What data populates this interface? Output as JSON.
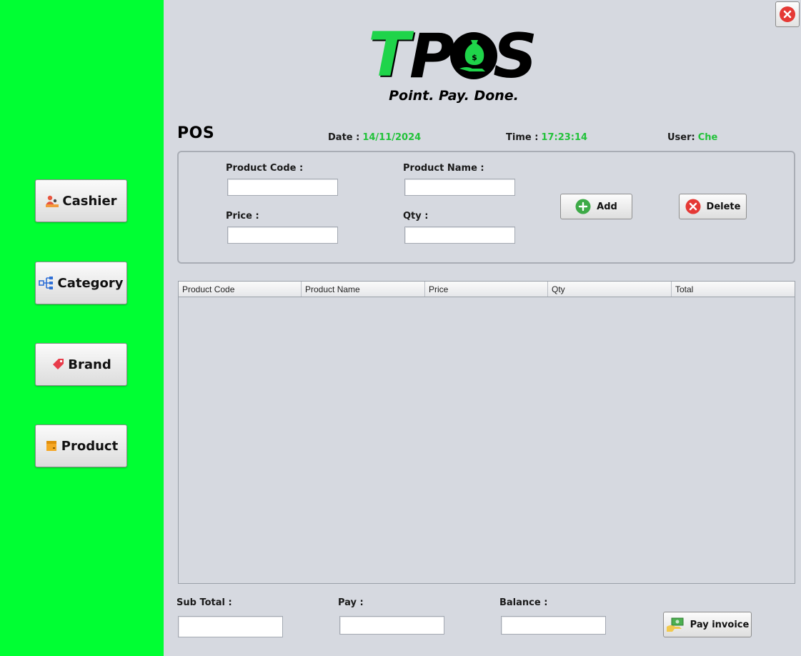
{
  "window": {
    "close_icon": "close-icon"
  },
  "sidebar": {
    "background": "#00ff33",
    "items": [
      {
        "label": "Cashier",
        "icon": "cashier-icon"
      },
      {
        "label": "Category",
        "icon": "hierarchy-icon"
      },
      {
        "label": "Brand",
        "icon": "tag-icon"
      },
      {
        "label": "Product",
        "icon": "box-icon"
      }
    ]
  },
  "logo": {
    "text": "TPOS",
    "tagline": "Point. Pay. Done."
  },
  "header": {
    "title": "POS",
    "date_label": "Date :",
    "date_value": "14/11/2024",
    "time_label": "Time :",
    "time_value": "17:23:14",
    "user_label": "User:",
    "user_value": "Che",
    "value_color": "#22c23a"
  },
  "form": {
    "product_code_label": "Product Code :",
    "product_code_value": "",
    "product_name_label": "Product Name :",
    "product_name_value": "",
    "price_label": "Price :",
    "price_value": "",
    "qty_label": "Qty :",
    "qty_value": "",
    "add_label": "Add",
    "delete_label": "Delete"
  },
  "table": {
    "columns": [
      "Product Code",
      "Product Name",
      "Price",
      "Qty",
      "Total"
    ],
    "rows": []
  },
  "footer": {
    "subtotal_label": "Sub Total :",
    "subtotal_value": "",
    "pay_label": "Pay :",
    "pay_value": "",
    "balance_label": "Balance :",
    "balance_value": "",
    "pay_invoice_label": "Pay invoice"
  }
}
